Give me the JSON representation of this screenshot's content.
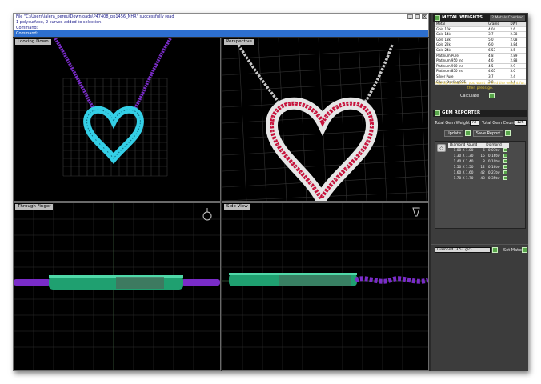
{
  "command": {
    "lines": [
      "File \"C:\\Users\\jalera_pereu\\Downloads\\P47408_pp1456_NHR\" successfully read",
      "1 polysurface, 2 curves added to selection.",
      "Command:"
    ],
    "prompt": "Command:"
  },
  "viewports": {
    "top": "Looking Down",
    "perspective": "Perspective",
    "front": "Through Finger",
    "right": "Side View"
  },
  "metal_weights": {
    "title": "METAL WEIGHTS",
    "badge": "2 Metals Checked",
    "headers": [
      "Metal",
      "Grams",
      "DWT"
    ],
    "rows": [
      [
        "Gold 10k",
        "4.04",
        "2.6"
      ],
      [
        "Gold 14k",
        "3.7",
        "2.38"
      ],
      [
        "Gold 18k",
        "5.0",
        "2.08"
      ],
      [
        "Gold 22k",
        "6.0",
        "3.84"
      ],
      [
        "Gold 24k",
        "6.53",
        "3.5"
      ],
      [
        "Platinum Pure",
        "4.8",
        "2.89"
      ],
      [
        "Platinum 950 Ind",
        "4.6",
        "2.88"
      ],
      [
        "Platinum 900 Ind",
        "4.5",
        "2.9"
      ],
      [
        "Platinum 850 Ind",
        "4.65",
        "3.0"
      ],
      [
        "Silver Pure",
        "3.7",
        "2.4"
      ],
      [
        "Silver Sterling 925",
        "3.8",
        "2.4"
      ]
    ],
    "highlight": "Highlight the item you want to find the weight for, then press go.",
    "calculate": "Calculate"
  },
  "gem_reporter": {
    "title": "GEM REPORTER",
    "total_weight_label": "Total Gem Weight",
    "total_weight_value": "nil",
    "total_count_label": "Total Gem Count",
    "total_count_value": "126",
    "update": "Update",
    "save_report": "Save Report",
    "gems": [
      {
        "type": "Diamond Round",
        "size": "1.00 X 1.00",
        "qty": "6",
        "weight": "0.07tw"
      },
      {
        "type": "Diamond Round",
        "size": "1.30 X 1.30",
        "qty": "15",
        "weight": "0.16tw"
      },
      {
        "type": "Diamond Round",
        "size": "1.40 X 1.40",
        "qty": "8",
        "weight": "0.10tw"
      },
      {
        "type": "Diamond Round",
        "size": "1.50 X 1.50",
        "qty": "12",
        "weight": "0.16tw"
      },
      {
        "type": "Diamond Round",
        "size": "1.60 X 1.60",
        "qty": "42",
        "weight": "0.27tw"
      },
      {
        "type": "Diamond Round",
        "size": "1.70 X 1.70",
        "qty": "43",
        "weight": "0.35tw"
      }
    ],
    "material_select": "Diamond (3.52 g/c)",
    "set_material": "Set Material"
  },
  "colors": {
    "viewport_bg": "#000000",
    "panel_bg": "#3c3c3c",
    "accent_green": "#58a64a",
    "command_blue": "#2d6fcf",
    "gem_cyan": "#34cfe6",
    "chain_purple": "#7a2cc8",
    "band_green": "#1fa070",
    "ruby_red": "#c8103a"
  }
}
